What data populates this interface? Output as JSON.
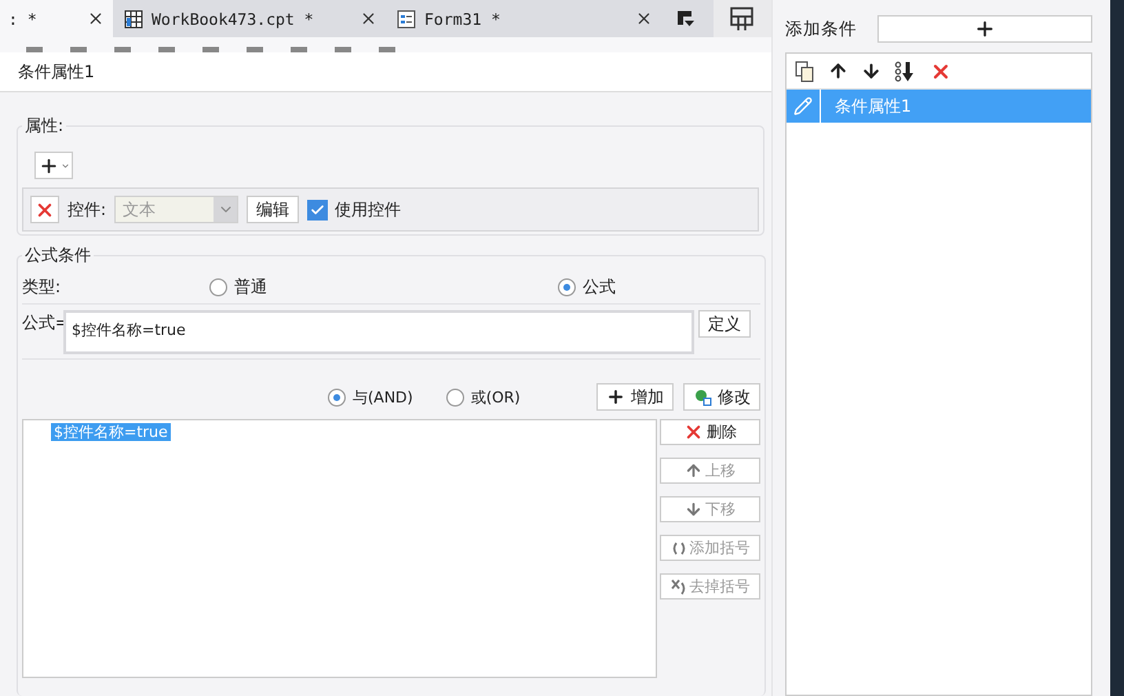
{
  "tabs": [
    {
      "label": ": *",
      "selected": true,
      "kind": "plain"
    },
    {
      "label": "WorkBook473.cpt *",
      "selected": false,
      "kind": "workbook"
    },
    {
      "label": "Form31 *",
      "selected": false,
      "kind": "form"
    }
  ],
  "dialog": {
    "title": "条件属性1",
    "attributes": {
      "title": "属性:",
      "control_label": "控件:",
      "control_value": "文本",
      "edit_button": "编辑",
      "use_control": {
        "label": "使用控件",
        "checked": true
      }
    },
    "formula_condition": {
      "title": "公式条件",
      "type_label": "类型:",
      "types": [
        {
          "label": "普通",
          "selected": false
        },
        {
          "label": "公式",
          "selected": true
        }
      ],
      "formula_label": "公式=",
      "formula_value": "$控件名称=true",
      "define_button": "定义",
      "logic": [
        {
          "label": "与(AND)",
          "selected": true
        },
        {
          "label": "或(OR)",
          "selected": false
        }
      ],
      "add_button": "增加",
      "modify_button": "修改",
      "conditions": [
        {
          "text": "$控件名称=true",
          "selected": true
        }
      ],
      "side_buttons": [
        {
          "label": "删除",
          "kind": "delete",
          "disabled": false
        },
        {
          "label": "上移",
          "kind": "up",
          "disabled": true
        },
        {
          "label": "下移",
          "kind": "down",
          "disabled": true
        },
        {
          "label": "添加括号",
          "kind": "add-paren",
          "disabled": true
        },
        {
          "label": "去掉括号",
          "kind": "remove-paren",
          "disabled": true
        }
      ]
    }
  },
  "conditions_panel": {
    "title": "添加条件",
    "items": [
      {
        "label": "条件属性1",
        "selected": true
      }
    ]
  }
}
